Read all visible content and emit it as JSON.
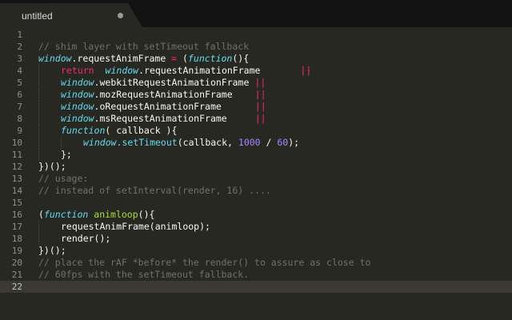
{
  "tab": {
    "title": "untitled"
  },
  "line_numbers": [
    "1",
    "2",
    "3",
    "4",
    "5",
    "6",
    "7",
    "8",
    "9",
    "10",
    "11",
    "12",
    "13",
    "14",
    "15",
    "16",
    "17",
    "18",
    "19",
    "20",
    "21",
    "22"
  ],
  "current_line": "22",
  "code": {
    "l2": "// shim layer with setTimeout fallback",
    "l3_window": "window",
    "l3_rest": ".requestAnimFrame ",
    "l3_eq": "=",
    "l3_paren": " (",
    "l3_function": "function",
    "l3_end": "(){",
    "l4_return": "return",
    "l4_window": "window",
    "l4_prop": ".requestAnimationFrame",
    "l4_or": "||",
    "l5_window": "window",
    "l5_prop": ".webkitRequestAnimationFrame",
    "l5_or": "||",
    "l6_window": "window",
    "l6_prop": ".mozRequestAnimationFrame",
    "l6_or": "||",
    "l7_window": "window",
    "l7_prop": ".oRequestAnimationFrame",
    "l7_or": "||",
    "l8_window": "window",
    "l8_prop": ".msRequestAnimationFrame",
    "l8_or": "||",
    "l9_function": "function",
    "l9_rest": "( callback ){",
    "l10_window": "window",
    "l10_set": ".setTimeout",
    "l10_args": "(callback, ",
    "l10_num1": "1000",
    "l10_div": " / ",
    "l10_num2": "60",
    "l10_end": ");",
    "l11": "};",
    "l12": "})();",
    "l13": "// usage:",
    "l14": "// instead of setInterval(render, 16) ....",
    "l16_open": "(",
    "l16_function": "function",
    "l16_name": "animloop",
    "l16_end": "(){",
    "l17": "requestAnimFrame(animloop);",
    "l18": "render();",
    "l19": "})();",
    "l20": "// place the rAF *before* the render() to assure as close to",
    "l21": "// 60fps with the setTimeout fallback."
  },
  "colors": {
    "background": "#272822",
    "comment": "#75715e",
    "keyword": "#f92672",
    "storage": "#66d9ef",
    "number": "#ae81ff",
    "entity": "#a6e22e",
    "text": "#f8f8f2"
  },
  "icons": {
    "tab_dirty_indicator": "dot"
  }
}
